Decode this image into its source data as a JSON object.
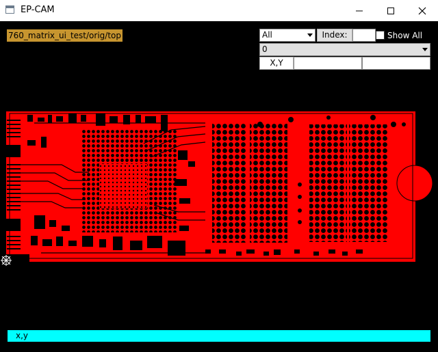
{
  "window": {
    "title": "EP-CAM",
    "minimize_icon": "minimize-icon",
    "maximize_icon": "maximize-icon",
    "close_icon": "close-icon"
  },
  "job_path": "760_matrix_ui_test/orig/top",
  "toolbar": {
    "filter_selected": "All",
    "index_label": "Index:",
    "index_value": "",
    "show_all_label": "Show All",
    "show_all_checked": false,
    "layer_selected": "0",
    "xy_button_label": "X,Y",
    "x_value": "",
    "y_value": ""
  },
  "status": {
    "coords": "x,y"
  },
  "colors": {
    "board_copper": "#ff0000",
    "status_bar": "#00ffff",
    "path_label_bg": "#c7952f"
  }
}
